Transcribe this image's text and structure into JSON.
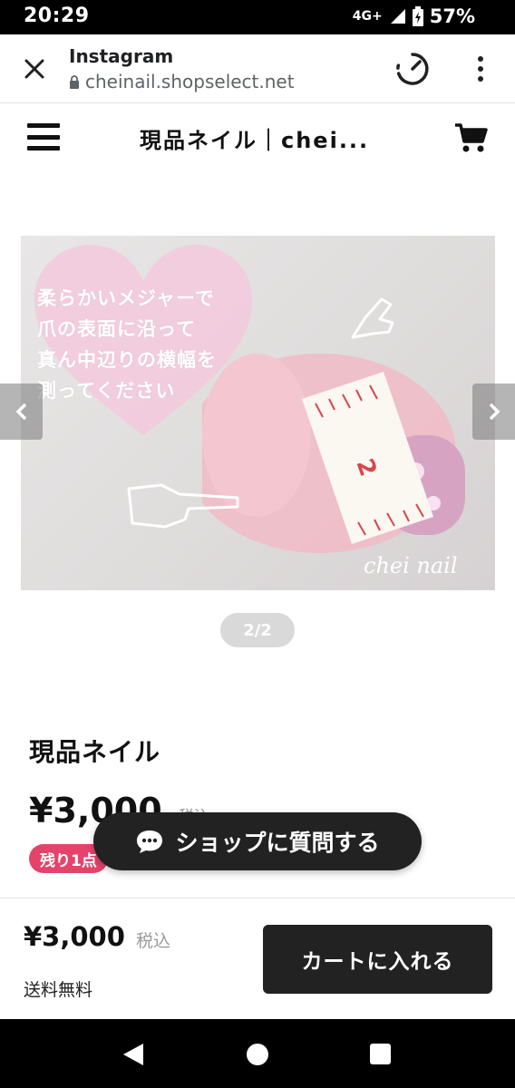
{
  "status_bar": {
    "time": "20:29",
    "network": "4G+",
    "battery": "57%"
  },
  "browser": {
    "title": "Instagram",
    "url": "cheinail.shopselect.net",
    "icons": [
      "close-icon",
      "lock-icon",
      "timer-icon",
      "more-vert-icon"
    ]
  },
  "shop_header": {
    "title": "現品ネイル｜chei...",
    "icons": [
      "menu-icon",
      "cart-icon"
    ]
  },
  "carousel": {
    "slide_text": "柔らかいメジャーで\n爪の表面に沿って\n真ん中辺りの横幅を\n測ってください",
    "watermark": "chei nail",
    "prev_label": "‹",
    "next_label": "›",
    "page_indicator": "2/2"
  },
  "product": {
    "name": "現品ネイル",
    "price": "¥3,000",
    "tax_label": "税込",
    "stock_badge": "残り1点"
  },
  "ask_shop": {
    "label": "ショップに質問する",
    "icon": "chat-bubble-icon"
  },
  "bottom_bar": {
    "price": "¥3,000",
    "tax_label": "税込",
    "shipping": "送料無料",
    "add_to_cart": "カートに入れる"
  },
  "colors": {
    "accent_dark": "#222222",
    "badge_pink": "#e6436b",
    "indicator_gray": "#d9d9d9"
  }
}
